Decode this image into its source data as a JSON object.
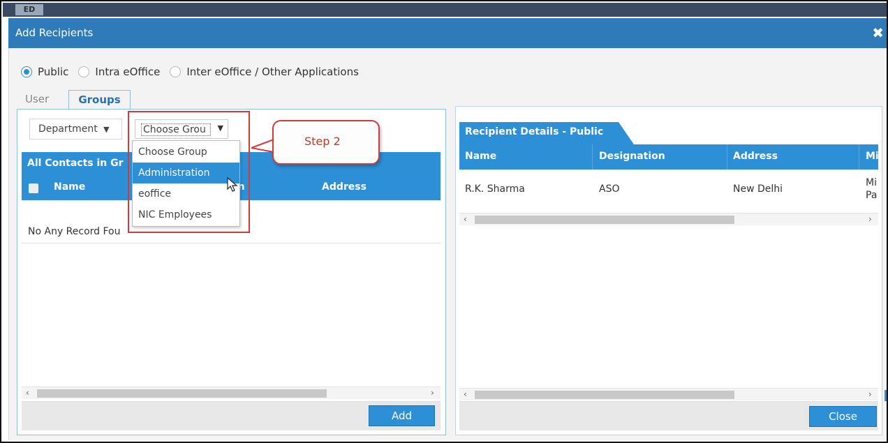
{
  "topstrip": {
    "label": "ED"
  },
  "dialog": {
    "title": "Add Recipients",
    "close_icon": "close-icon"
  },
  "recipient_type": {
    "options": [
      {
        "label": "Public",
        "selected": true
      },
      {
        "label": "Intra eOffice",
        "selected": false
      },
      {
        "label": "Inter eOffice / Other Applications",
        "selected": false
      }
    ]
  },
  "tabs": [
    {
      "label": "User",
      "active": false
    },
    {
      "label": "Groups",
      "active": true
    }
  ],
  "left": {
    "department_button": "Department",
    "group_select": {
      "value": "Choose Grou",
      "caret": "▼"
    },
    "dept_caret": "▼",
    "panel_title": "All Contacts in Gr",
    "columns": [
      "Name",
      "on",
      "Address"
    ],
    "empty_text": "No Any Record Fou",
    "add_button": "Add"
  },
  "dropdown": {
    "options": [
      {
        "label": "Choose Group",
        "selected": false
      },
      {
        "label": "Administration",
        "selected": true
      },
      {
        "label": "eoffice",
        "selected": false
      },
      {
        "label": "NIC Employees",
        "selected": false
      }
    ]
  },
  "callout": {
    "text": "Step 2"
  },
  "right": {
    "panel_title": "Recipient Details - Public",
    "columns": [
      "Name",
      "Designation",
      "Address",
      "Mi"
    ],
    "rows": [
      {
        "name": "R.K. Sharma",
        "designation": "ASO",
        "address": "New Delhi",
        "extra_line1": "Mi",
        "extra_line2": "Pa"
      }
    ],
    "close_button": "Close"
  },
  "scroll": {
    "left_arrow": "‹",
    "right_arrow": "›"
  },
  "colors": {
    "title_bar": "#2f7ab8",
    "accent": "#2d8fd5",
    "annotation": "#d23a3a"
  }
}
